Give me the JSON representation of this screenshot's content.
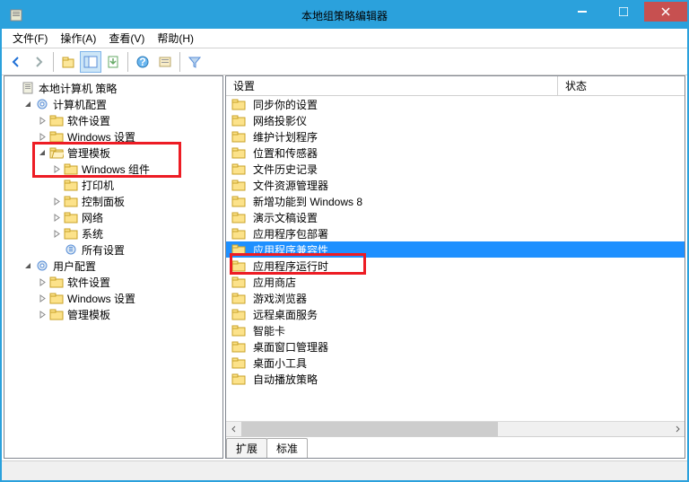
{
  "window": {
    "title": "本地组策略编辑器"
  },
  "menu": {
    "file": "文件(F)",
    "action": "操作(A)",
    "view": "查看(V)",
    "help": "帮助(H)"
  },
  "tree": {
    "root": "本地计算机 策略",
    "computer": "计算机配置",
    "software1": "软件设置",
    "winset1": "Windows 设置",
    "admintpl1": "管理模板",
    "wincomp": "Windows 组件",
    "printer": "打印机",
    "ctrlpanel": "控制面板",
    "network": "网络",
    "system": "系统",
    "allset": "所有设置",
    "user": "用户配置",
    "software2": "软件设置",
    "winset2": "Windows 设置",
    "admintpl2": "管理模板"
  },
  "columns": {
    "setting": "设置",
    "state": "状态"
  },
  "items": [
    "同步你的设置",
    "网络投影仪",
    "维护计划程序",
    "位置和传感器",
    "文件历史记录",
    "文件资源管理器",
    "新增功能到 Windows 8",
    "演示文稿设置",
    "应用程序包部署",
    "应用程序兼容性",
    "应用程序运行时",
    "应用商店",
    "游戏浏览器",
    "远程桌面服务",
    "智能卡",
    "桌面窗口管理器",
    "桌面小工具",
    "自动播放策略"
  ],
  "selected_index": 9,
  "tabs": {
    "extended": "扩展",
    "standard": "标准"
  },
  "watermark": ""
}
